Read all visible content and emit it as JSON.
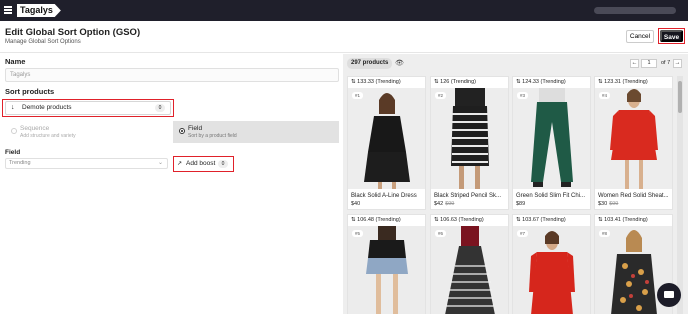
{
  "topbar": {
    "logo": "Tagalys"
  },
  "header": {
    "title": "Edit Global Sort Option (GSO)",
    "subtitle": "Manage Global Sort Options",
    "cancel_label": "Cancel",
    "save_label": "Save"
  },
  "form": {
    "name_label": "Name",
    "name_value": "Tagalys",
    "sort_products_label": "Sort products",
    "demote": {
      "label": "Demote products",
      "count": "0"
    },
    "sequence": {
      "title": "Sequence",
      "subtitle": "Add structure and variety",
      "selected": false
    },
    "field_option": {
      "title": "Field",
      "subtitle": "Sort by a product field",
      "selected": true
    },
    "field_label": "Field",
    "field_value": "Trending",
    "boost": {
      "label": "Add boost",
      "count": "0"
    }
  },
  "preview": {
    "count_label": "297 products",
    "page_value": "1",
    "page_total": "of 7",
    "products": [
      {
        "score": "133.33 (Trending)",
        "position": "#1",
        "title": "Black Solid A-Line Dress",
        "price": "$40",
        "old_price": ""
      },
      {
        "score": "126 (Trending)",
        "position": "#2",
        "title": "Black Striped Pencil Sk...",
        "price": "$42",
        "old_price": "$99"
      },
      {
        "score": "124.33 (Trending)",
        "position": "#3",
        "title": "Green Solid Slim Fit Chi...",
        "price": "$89",
        "old_price": ""
      },
      {
        "score": "123.31 (Trending)",
        "position": "#4",
        "title": "Women Red Solid Sheat...",
        "price": "$30",
        "old_price": "$99"
      },
      {
        "score": "106.48 (Trending)",
        "position": "#5",
        "title": "",
        "price": "",
        "old_price": ""
      },
      {
        "score": "106.63 (Trending)",
        "position": "#6",
        "title": "",
        "price": "",
        "old_price": ""
      },
      {
        "score": "103.67 (Trending)",
        "position": "#7",
        "title": "",
        "price": "",
        "old_price": ""
      },
      {
        "score": "103.41 (Trending)",
        "position": "#8",
        "title": "",
        "price": "",
        "old_price": ""
      }
    ]
  },
  "colors": {
    "topbar": "#1f1f2b",
    "highlight": "#e0212a",
    "save": "#16161e"
  }
}
